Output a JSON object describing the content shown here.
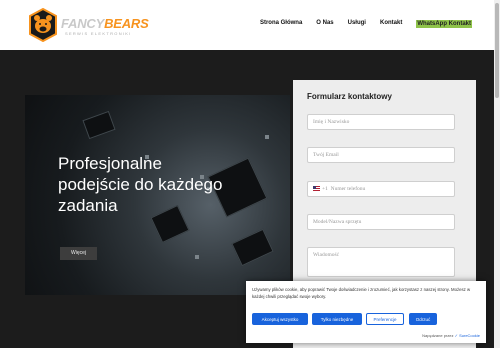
{
  "header": {
    "logo_fancy": "FANCY",
    "logo_bears": "BEARS",
    "logo_sub": "SERWIS ELEKTRONIKI",
    "nav": [
      {
        "label": "Strona Główna"
      },
      {
        "label": "O Nas"
      },
      {
        "label": "Usługi"
      },
      {
        "label": "Kontakt"
      },
      {
        "label": "WhatsApp Kontakt"
      }
    ]
  },
  "hero": {
    "title": "Profesjonalne podejście do każdego zadania",
    "button": "Więcej"
  },
  "form": {
    "title": "Formularz kontaktowy",
    "name_placeholder": "Imię i Nazwisko",
    "email_placeholder": "Twój Email",
    "phone_prefix": "+1",
    "phone_placeholder": "Numer telefonu",
    "device_placeholder": "Model/Nazwa sprzętu",
    "message_placeholder": "Wiadomość"
  },
  "cookie": {
    "text": "Używamy plików cookie, aby poprawić Twoje doświadczenie i zrozumieć, jak korzystasz z naszej strony. Możesz w każdej chwili przeglądać swoje wybory.",
    "accept_all": "Akceptuj wszystko",
    "necessary_only": "Tylko niezbędne",
    "preferences": "Preferencje",
    "reject": "Odrzuć",
    "powered_by": "Napędzane przez",
    "brand": "SureCookie"
  },
  "colors": {
    "accent_orange": "#f7931e",
    "whatsapp_green": "#8fc34a",
    "cookie_blue": "#1863dc"
  }
}
